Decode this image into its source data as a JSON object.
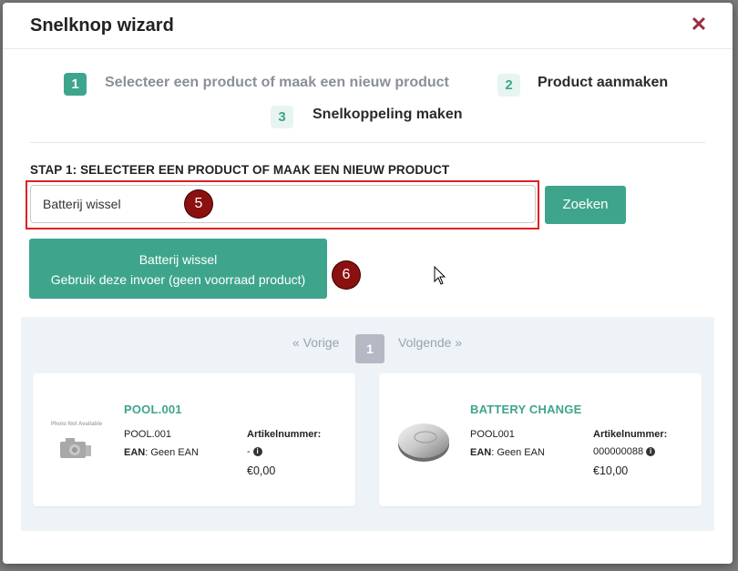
{
  "modal": {
    "title": "Snelknop wizard",
    "close_icon": "close-icon",
    "close_glyph": "✕"
  },
  "steps": [
    {
      "number": "1",
      "label": "Selecteer een product of maak een nieuw product",
      "state": "active"
    },
    {
      "number": "2",
      "label": "Product aanmaken",
      "state": "inactive"
    },
    {
      "number": "3",
      "label": "Snelkoppeling maken",
      "state": "inactive"
    }
  ],
  "step1": {
    "heading": "STAP 1: SELECTEER EEN PRODUCT OF MAAK EEN NIEUW PRODUCT",
    "search_value": "Batterij wissel",
    "search_button": "Zoeken",
    "use_input_line1": "Batterij wissel",
    "use_input_line2": "Gebruik deze invoer (geen voorraad product)"
  },
  "markers": [
    "5",
    "6"
  ],
  "pagination": {
    "prev": "« Vorige",
    "current": "1",
    "next": "Volgende »"
  },
  "products": [
    {
      "title": "POOL.001",
      "sku": "POOL.001",
      "ean_label": "EAN",
      "ean_value": ": Geen EAN",
      "article_label": "Artikelnummer:",
      "article_value": "-",
      "price": "€0,00",
      "image": "photo-not-available-icon",
      "image_text": "Photo Not Available"
    },
    {
      "title": "BATTERY CHANGE",
      "sku": "POOL001",
      "ean_label": "EAN",
      "ean_value": ": Geen EAN",
      "article_label": "Artikelnummer:",
      "article_value": "000000088",
      "price": "€10,00",
      "image": "coin-battery-icon"
    }
  ],
  "colors": {
    "accent": "#3ea58c",
    "close": "#9b2c40",
    "highlight_border": "#e02020",
    "marker": "#8b1010"
  }
}
